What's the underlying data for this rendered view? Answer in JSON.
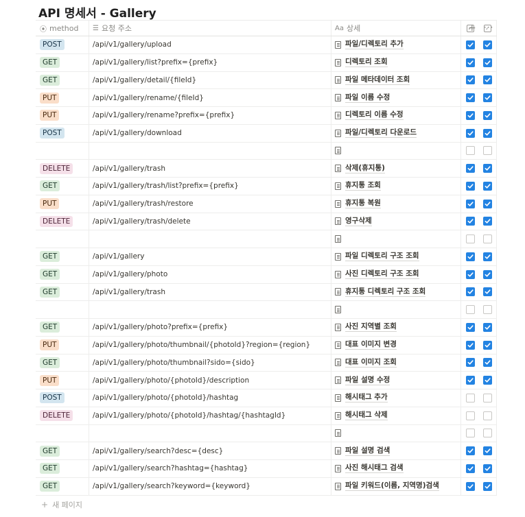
{
  "page": {
    "title": "API 명세서 - Gallery"
  },
  "header": {
    "method_label": "method",
    "url_label": "요청 주소",
    "detail_label": "상세",
    "detail_prefix": "Aa"
  },
  "rows": [
    {
      "method": "POST",
      "url": "/api/v1/gallery/upload",
      "detail": "파일/디렉토리 추가",
      "cb1": true,
      "cb2": true
    },
    {
      "method": "GET",
      "url": "/api/v1/gallery/list?prefix={prefix}",
      "detail": "디렉토리 조회",
      "cb1": true,
      "cb2": true
    },
    {
      "method": "GET",
      "url": "/api/v1/gallery/detail/{fileId}",
      "detail": "파일 메타데이터 조회",
      "cb1": true,
      "cb2": true
    },
    {
      "method": "PUT",
      "url": "/api/v1/gallery/rename/{fileId}",
      "detail": "파일 이름 수정",
      "cb1": true,
      "cb2": true
    },
    {
      "method": "PUT",
      "url": "/api/v1/gallery/rename?prefix={prefix}",
      "detail": "디렉토리 이름 수정",
      "cb1": true,
      "cb2": true
    },
    {
      "method": "POST",
      "url": "/api/v1/gallery/download",
      "detail": "파일/디렉토리 다운로드",
      "cb1": true,
      "cb2": true
    },
    {
      "method": "",
      "url": "",
      "detail": "",
      "cb1": false,
      "cb2": false
    },
    {
      "method": "DELETE",
      "url": "/api/v1/gallery/trash",
      "detail": "삭제(휴지통)",
      "cb1": true,
      "cb2": true
    },
    {
      "method": "GET",
      "url": "/api/v1/gallery/trash/list?prefix={prefix}",
      "detail": "휴지통 조회",
      "cb1": true,
      "cb2": true
    },
    {
      "method": "PUT",
      "url": "/api/v1/gallery/trash/restore",
      "detail": "휴지통 복원",
      "cb1": true,
      "cb2": true
    },
    {
      "method": "DELETE",
      "url": "/api/v1/gallery/trash/delete",
      "detail": "영구삭제",
      "cb1": true,
      "cb2": true
    },
    {
      "method": "",
      "url": "",
      "detail": "",
      "cb1": false,
      "cb2": false
    },
    {
      "method": "GET",
      "url": "/api/v1/gallery",
      "detail": "파일 디렉토리 구조 조회",
      "cb1": true,
      "cb2": true
    },
    {
      "method": "GET",
      "url": "/api/v1/gallery/photo",
      "detail": "사진 디렉토리 구조 조회",
      "cb1": true,
      "cb2": true
    },
    {
      "method": "GET",
      "url": "/api/v1/gallery/trash",
      "detail": "휴지통 디렉토리 구조 조회",
      "cb1": true,
      "cb2": true
    },
    {
      "method": "",
      "url": "",
      "detail": "",
      "cb1": false,
      "cb2": false
    },
    {
      "method": "GET",
      "url": "/api/v1/gallery/photo?prefix={prefix}",
      "detail": "사진 지역별 조회",
      "cb1": true,
      "cb2": true
    },
    {
      "method": "PUT",
      "url": "/api/v1/gallery/photo/thumbnail/{photoId}?region={region}",
      "detail": "대표 이미지 변경",
      "cb1": true,
      "cb2": true
    },
    {
      "method": "GET",
      "url": "/api/v1/gallery/photo/thumbnail?sido={sido}",
      "detail": "대표 이미지 조회",
      "cb1": true,
      "cb2": true
    },
    {
      "method": "PUT",
      "url": "/api/v1/gallery/photo/{photoId}/description",
      "detail": "파일 설명 수정",
      "cb1": true,
      "cb2": true
    },
    {
      "method": "POST",
      "url": "/api/v1/gallery/photo/{photoId}/hashtag",
      "detail": "해시태그 추가",
      "cb1": false,
      "cb2": false
    },
    {
      "method": "DELETE",
      "url": "/api/v1/gallery/photo/{photoId}/hashtag/{hashtagId}",
      "detail": "해시태그 삭제",
      "cb1": false,
      "cb2": false
    },
    {
      "method": "",
      "url": "",
      "detail": "",
      "cb1": false,
      "cb2": false
    },
    {
      "method": "GET",
      "url": "/api/v1/gallery/search?desc={desc}",
      "detail": "파일 설명 검색",
      "cb1": true,
      "cb2": true
    },
    {
      "method": "GET",
      "url": "/api/v1/gallery/search?hashtag={hashtag}",
      "detail": "사진 해시태그 검색",
      "cb1": true,
      "cb2": true
    },
    {
      "method": "GET",
      "url": "/api/v1/gallery/search?keyword={keyword}",
      "detail": "파일 키워드(이름, 지역명)검색",
      "cb1": true,
      "cb2": true
    }
  ],
  "footer": {
    "new_page_label": "새 페이지"
  },
  "colors": {
    "checkbox_on": "#2383e2",
    "POST": "#d3e5ef",
    "GET": "#dbeddb",
    "PUT": "#fadec9",
    "DELETE": "#f5e0e9"
  }
}
